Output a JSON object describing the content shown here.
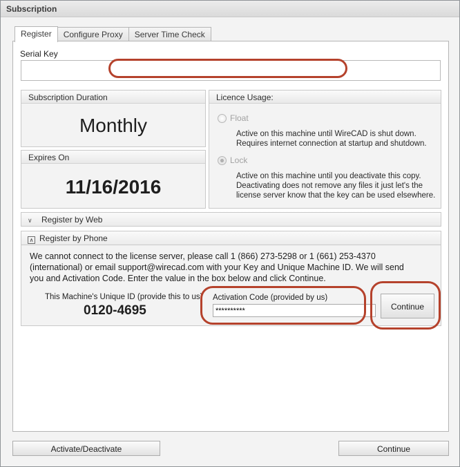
{
  "window": {
    "title": "Subscription"
  },
  "tabs": [
    {
      "label": "Register",
      "active": true
    },
    {
      "label": "Configure Proxy",
      "active": false
    },
    {
      "label": "Server Time Check",
      "active": false
    }
  ],
  "serial_key": {
    "label": "Serial Key",
    "value": ""
  },
  "subscription_duration": {
    "header": "Subscription Duration",
    "value": "Monthly"
  },
  "expires_on": {
    "header": "Expires On",
    "value": "11/16/2016"
  },
  "licence_usage": {
    "header": "Licence Usage:",
    "float": {
      "label": "Float",
      "checked": false,
      "desc1": "Active on this machine until WireCAD is shut down.",
      "desc2": "Requires internet connection at startup and shutdown."
    },
    "lock": {
      "label": "Lock",
      "checked": true,
      "desc1": "Active on this machine until you deactivate this copy.",
      "desc2": "Deactivating does not remove any files it just let's the",
      "desc3": "license server know that the key can be used elsewhere."
    }
  },
  "register_by_web": {
    "label": "Register by Web",
    "icon": "chevron-down-icon"
  },
  "register_by_phone": {
    "label": "Register by Phone",
    "icon": "collapse-box-icon",
    "instructions_line1": "We cannot connect to the license server, please call 1 (866) 273-5298 or 1 (661) 253-4370",
    "instructions_line2": "(international) or email support@wirecad.com with your Key and Unique Machine ID. We will send",
    "instructions_line3": "you and Activation Code. Enter the value in the box below and click Continue.",
    "machine_id_label": "This Machine's Unique ID (provide this to us)",
    "machine_id": "0120-4695",
    "activation_label": "Activation Code (provided by us)",
    "activation_value": "**********",
    "continue_label": "Continue"
  },
  "footer": {
    "activate_label": "Activate/Deactivate",
    "continue_label": "Continue"
  },
  "colors": {
    "highlight": "#b5422c"
  }
}
